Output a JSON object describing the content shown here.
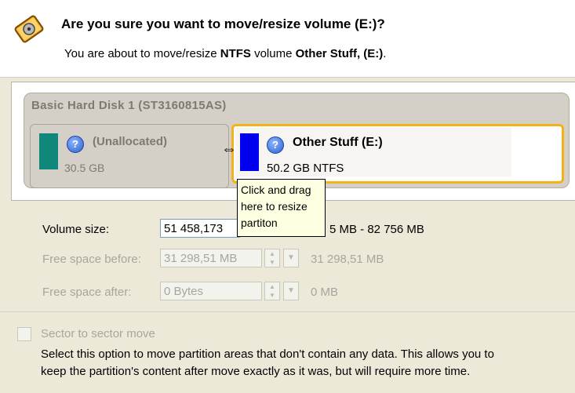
{
  "header": {
    "title": "Are you sure you want to move/resize volume (E:)?",
    "subtitle_prefix": "You are about to move/resize ",
    "subtitle_fs": "NTFS",
    "subtitle_mid": " volume ",
    "subtitle_volume": "Other Stuff, (E:)",
    "subtitle_end": "."
  },
  "disk": {
    "label": "Basic Hard Disk 1 (ST3160815AS)",
    "volumes": [
      {
        "label": "(Unallocated)",
        "size": "30.5 GB",
        "color": "#10877b",
        "icon": "help-icon"
      },
      {
        "label": "Other Stuff (E:)",
        "size": "50.2 GB NTFS",
        "color": "#0000ee",
        "icon": "help-icon"
      }
    ]
  },
  "tooltip": {
    "line1": "Click and drag",
    "line2": "here to resize",
    "line3": "partiton"
  },
  "fields": {
    "volume_size_label": "Volume size:",
    "volume_size_value": "51 458,173",
    "volume_size_range": "5 MB - 82 756 MB",
    "free_before_label": "Free space before:",
    "free_before_value": "31 298,51 MB",
    "free_before_note": "31 298,51 MB",
    "free_after_label": "Free space after:",
    "free_after_value": "0 Bytes",
    "free_after_note": "0 MB"
  },
  "sector": {
    "label": "Sector to sector move",
    "checked": false,
    "desc_line1": "Select this option to move partition areas that don't contain any data. This allows you to",
    "desc_line2": "keep the partition's content after move exactly as it was, but will require more time."
  },
  "colors": {
    "accent": "#f2b318",
    "unallocated": "#10877b",
    "ntfs": "#0000ee"
  }
}
